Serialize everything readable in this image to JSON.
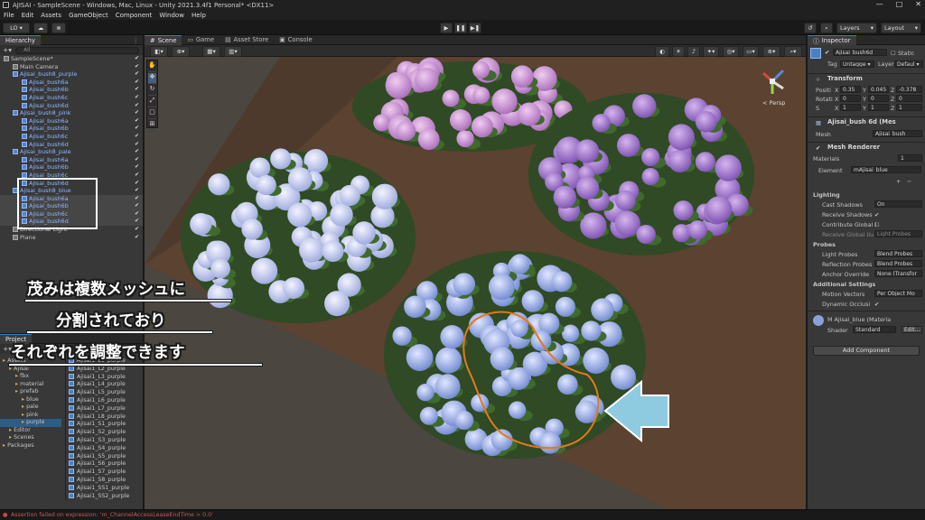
{
  "window": {
    "title": "AJISAI - SampleScene - Windows, Mac, Linux - Unity 2021.3.4f1 Personal* <DX11>",
    "controls": [
      "—",
      "□",
      "✕"
    ]
  },
  "menu": [
    "File",
    "Edit",
    "Assets",
    "GameObject",
    "Component",
    "Window",
    "Help"
  ],
  "toolbar": {
    "account": "LO ▾",
    "layers": "Layers",
    "layout": "Layout"
  },
  "hierarchy": {
    "tab": "Hierarchy",
    "search_placeholder": "All",
    "rows": [
      {
        "name": "SampleScene*",
        "indent": 0,
        "style": "scene"
      },
      {
        "name": "Main Camera",
        "indent": 1,
        "style": "g"
      },
      {
        "name": "Ajisai_bush8_purple",
        "indent": 1,
        "style": "blue"
      },
      {
        "name": "Ajisai_bush6a",
        "indent": 2,
        "style": "blue"
      },
      {
        "name": "Ajisai_bush6b",
        "indent": 2,
        "style": "blue"
      },
      {
        "name": "Ajisai_bush6c",
        "indent": 2,
        "style": "blue"
      },
      {
        "name": "Ajisai_bush6d",
        "indent": 2,
        "style": "blue"
      },
      {
        "name": "Ajisai_bush8_pink",
        "indent": 1,
        "style": "blue"
      },
      {
        "name": "Ajisai_bush6a",
        "indent": 2,
        "style": "blue"
      },
      {
        "name": "Ajisai_bush6b",
        "indent": 2,
        "style": "blue"
      },
      {
        "name": "Ajisai_bush6c",
        "indent": 2,
        "style": "blue"
      },
      {
        "name": "Ajisai_bush6d",
        "indent": 2,
        "style": "blue"
      },
      {
        "name": "Ajisai_bush8_pale",
        "indent": 1,
        "style": "blue"
      },
      {
        "name": "Ajisai_bush6a",
        "indent": 2,
        "style": "blue"
      },
      {
        "name": "Ajisai_bush6b",
        "indent": 2,
        "style": "blue"
      },
      {
        "name": "Ajisai_bush6c",
        "indent": 2,
        "style": "blue"
      },
      {
        "name": "Ajisai_bush6d",
        "indent": 2,
        "style": "blue"
      },
      {
        "name": "Ajisai_bush8_blue",
        "indent": 1,
        "style": "blue"
      },
      {
        "name": "Ajisai_bush6a",
        "indent": 2,
        "style": "hl"
      },
      {
        "name": "Ajisai_bush6b",
        "indent": 2,
        "style": "hl"
      },
      {
        "name": "Ajisai_bush6c",
        "indent": 2,
        "style": "hl"
      },
      {
        "name": "Ajisai_bush6d",
        "indent": 2,
        "style": "hl"
      },
      {
        "name": "Directional Light",
        "indent": 1,
        "style": "g"
      },
      {
        "name": "Plane",
        "indent": 1,
        "style": "g"
      }
    ]
  },
  "scene_tabs": [
    "Scene",
    "Game",
    "Asset Store",
    "Console"
  ],
  "scene": {
    "persp_label": "< Persp"
  },
  "caption": {
    "line1": "茂みは複数メッシュに",
    "line2": "分割されており",
    "line3": "それぞれを調整できます"
  },
  "project": {
    "tab": "Project",
    "folders": [
      {
        "name": "Assets",
        "indent": 0
      },
      {
        "name": "Ajisai",
        "indent": 1
      },
      {
        "name": "fbx",
        "indent": 2
      },
      {
        "name": "material",
        "indent": 2
      },
      {
        "name": "prefab",
        "indent": 2
      },
      {
        "name": "blue",
        "indent": 3
      },
      {
        "name": "pale",
        "indent": 3
      },
      {
        "name": "pink",
        "indent": 3
      },
      {
        "name": "purple",
        "indent": 3
      },
      {
        "name": "Editor",
        "indent": 1
      },
      {
        "name": "Scenes",
        "indent": 1
      },
      {
        "name": "Packages",
        "indent": 0
      }
    ],
    "files": [
      "Ajisai1_L1_purple",
      "Ajisai1_L2_purple",
      "Ajisai1_L3_purple",
      "Ajisai1_L4_purple",
      "Ajisai1_L5_purple",
      "Ajisai1_L6_purple",
      "Ajisai1_L7_purple",
      "Ajisai1_L8_purple",
      "Ajisai1_S1_purple",
      "Ajisai1_S2_purple",
      "Ajisai1_S3_purple",
      "Ajisai1_S4_purple",
      "Ajisai1_S5_purple",
      "Ajisai1_S6_purple",
      "Ajisai1_S7_purple",
      "Ajisai1_S8_purple",
      "Ajisai1_SS1_purple",
      "Ajisai1_SS2_purple"
    ]
  },
  "inspector": {
    "tab": "Inspector",
    "object_name": "Ajisai_bush6d",
    "static_label": "Static",
    "tag_label": "Tag",
    "tag_value": "Untagge ▾",
    "layer_label": "Layer",
    "layer_value": "Defaul ▾",
    "transform": {
      "title": "Transform",
      "position_label": "Positi",
      "rotation_label": "Rotati",
      "scale_label": "S",
      "position": [
        "0.35",
        "0.045",
        "-0.378"
      ],
      "rotation": [
        "0",
        "0",
        "0"
      ],
      "scale": [
        "1",
        "1",
        "1"
      ]
    },
    "mesh_filter": {
      "title": "Ajisai_bush 6d (Mes",
      "mesh_label": "Mesh",
      "mesh_value": "Ajisai_bush"
    },
    "mesh_renderer": {
      "title": "Mesh Renderer",
      "materials_label": "Materials",
      "materials_count": "1",
      "element_label": "Element",
      "element_value": "mAjisai_blue",
      "lighting_label": "Lighting",
      "cast_shadows_label": "Cast Shadows",
      "cast_shadows_value": "On",
      "receive_shadows_label": "Receive Shadows",
      "contribute_gi_label": "Contribute Global I",
      "receive_gi_label": "Receive Global Ilu",
      "receive_gi_value": "Light Probes",
      "probes_label": "Probes",
      "light_probes_label": "Light Probes",
      "light_probes_value": "Blend Probes",
      "reflection_probes_label": "Reflection Probes",
      "reflection_probes_value": "Blend Probes",
      "anchor_override_label": "Anchor Override",
      "anchor_override_value": "None (Transfor",
      "additional_label": "Additional Settings",
      "motion_vectors_label": "Motion Vectors",
      "motion_vectors_value": "Per Object Mo",
      "dynamic_occlusion_label": "Dynamic Occlusi"
    },
    "material": {
      "name": "M Ajisai_blue (Materia",
      "shader_label": "Shader",
      "shader_value": "Standard",
      "edit_label": "Edit..."
    },
    "add_component": "Add Component"
  },
  "status": {
    "message": "Assertion failed on expression: 'm_ChannelAccessLeaseEndTime > 0.0'"
  },
  "colors": {
    "selection_box": "#ffffff",
    "arrow": "#8fcbe0",
    "outline": "#e2791c",
    "accent": "#3a79bb"
  }
}
